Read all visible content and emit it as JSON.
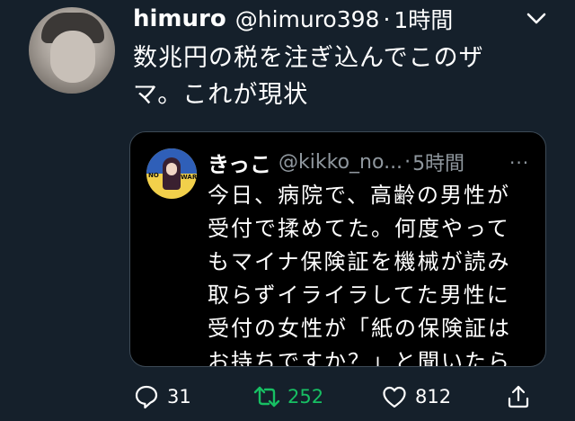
{
  "tweet": {
    "author_name": "himuro",
    "author_handle": "@himuro398",
    "separator": "·",
    "time": "1時間",
    "text_lines": [
      "数兆円の税を注ぎ込んでこのザ",
      "マ。これが現状"
    ]
  },
  "quote": {
    "author_name": "きっこ",
    "author_handle": "@kikko_no...",
    "separator": "·",
    "time": "5時間",
    "more": "···",
    "avatar_labels": {
      "left": "NO",
      "right": "WAR"
    },
    "text_lines": [
      "今日、病院で、高齢の男性が",
      "受付で揉めてた。何度やって",
      "もマイナ保険証を機械が読み",
      "取らずイライラしてた男性に",
      "受付の女性が「紙の保険証は",
      "お持ちですか？」と聞いたら"
    ]
  },
  "actions": {
    "reply_count": "31",
    "retweet_count": "252",
    "like_count": "812",
    "retweet_color": "#17bf63"
  },
  "icons": [
    "chevron-down-icon",
    "reply-icon",
    "retweet-icon",
    "like-icon",
    "share-icon"
  ]
}
